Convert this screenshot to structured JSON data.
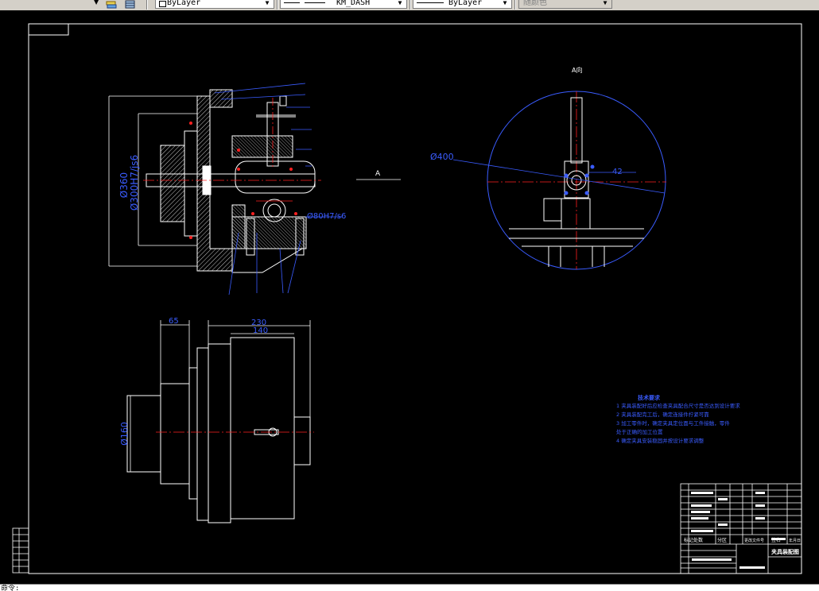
{
  "toolbar": {
    "layer_combo": "ByLayer",
    "linetype_combo": "KM_DASH",
    "lineweight_combo": "ByLayer",
    "plotstyle_combo": "随颜色"
  },
  "drawing": {
    "main_view_label": "",
    "section_label_a": "A",
    "view_a_title": "A向",
    "dim_d360": "Ø360",
    "dim_d300": "Ø300H7/js6",
    "dim_d80": "Ø80H7/s6",
    "dim_d400": "Ø400",
    "dim_42": "42",
    "dim_65": "65",
    "dim_230": "230",
    "dim_140": "140",
    "dim_d160": "Ø160",
    "tech_req_title": "技术要求",
    "tech_req": [
      "1 夹具装配好后应检查夹具配合尺寸是否达到设计要求",
      "2 夹具装配完工后，确定连接件拧紧可靠",
      "3 加工零件时，确定夹具定位面与工件接触，零件",
      "   处于正确的加工位置",
      "4 确定夹具安装稳固并按设计要求调整"
    ],
    "title_block_name": "夹具装配图",
    "title_block_header": [
      "标记",
      "处数",
      "分区",
      "更改文件号",
      "签名",
      "年月日"
    ]
  },
  "command_line": "命令:"
}
